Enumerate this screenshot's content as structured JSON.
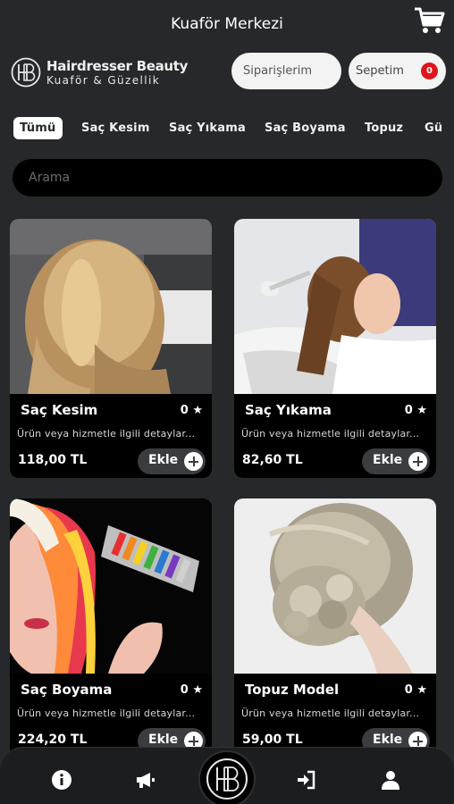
{
  "header": {
    "title": "Kuaför Merkezi",
    "cart_icon": "shopping-cart-icon"
  },
  "brand": {
    "logo_icon": "hb-monogram-logo",
    "name": "Hairdresser Beauty",
    "subtitle": "Kuaför & Güzellik"
  },
  "actions": {
    "orders_label": "Siparişlerim",
    "cart_label": "Sepetim",
    "cart_count": "0"
  },
  "categories": [
    {
      "label": "Tümü",
      "active": true
    },
    {
      "label": "Saç Kesim",
      "active": false
    },
    {
      "label": "Saç Yıkama",
      "active": false
    },
    {
      "label": "Saç Boyama",
      "active": false
    },
    {
      "label": "Topuz",
      "active": false
    },
    {
      "label": "Gü",
      "active": false
    }
  ],
  "search": {
    "placeholder": "Arama",
    "value": ""
  },
  "products": [
    {
      "title": "Saç Kesim",
      "rating": "0 ★",
      "description": "Ürün veya hizmetle ilgili detaylar...",
      "price": "118,00 TL",
      "add_label": "Ekle"
    },
    {
      "title": "Saç Yıkama",
      "rating": "0 ★",
      "description": "Ürün veya hizmetle ilgili detaylar...",
      "price": "82,60 TL",
      "add_label": "Ekle"
    },
    {
      "title": "Saç Boyama",
      "rating": "0 ★",
      "description": "Ürün veya hizmetle ilgili detaylar...",
      "price": "224,20 TL",
      "add_label": "Ekle"
    },
    {
      "title": "Topuz Model",
      "rating": "0 ★",
      "description": "Ürün veya hizmetle ilgili detaylar...",
      "price": "59,00 TL",
      "add_label": "Ekle"
    }
  ],
  "bottom_nav": {
    "items": [
      "info-icon",
      "megaphone-icon",
      "hb-logo-home",
      "login-icon",
      "user-icon"
    ]
  },
  "colors": {
    "background": "#26282b",
    "card": "#000000",
    "badge": "#e0151b",
    "pill": "#f3f3f3"
  }
}
